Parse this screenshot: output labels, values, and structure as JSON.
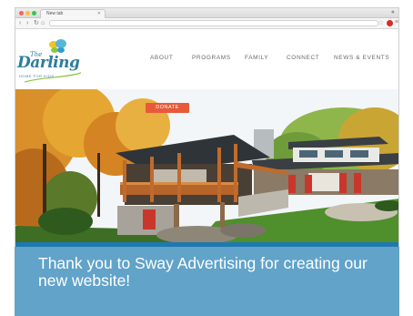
{
  "browser": {
    "tab_title": "New tab",
    "url": ""
  },
  "site": {
    "logo": {
      "prefix": "The",
      "name": "Darling",
      "tagline": "HOME FOR KIDS"
    },
    "nav": [
      "ABOUT",
      "PROGRAMS",
      "FAMILY",
      "CONNECT",
      "NEWS & EVENTS"
    ],
    "donate_label": "DONATE"
  },
  "caption": "Thank you to Sway Advertising for creating our new website!",
  "colors": {
    "brand_teal": "#2e7d9c",
    "donate_orange": "#e8593a",
    "strip_blue": "#1e79b1",
    "caption_bg": "#61a3c9"
  },
  "icons": [
    "back-icon",
    "forward-icon",
    "reload-icon",
    "home-icon",
    "star-icon",
    "menu-icon",
    "butterfly-icon"
  ]
}
